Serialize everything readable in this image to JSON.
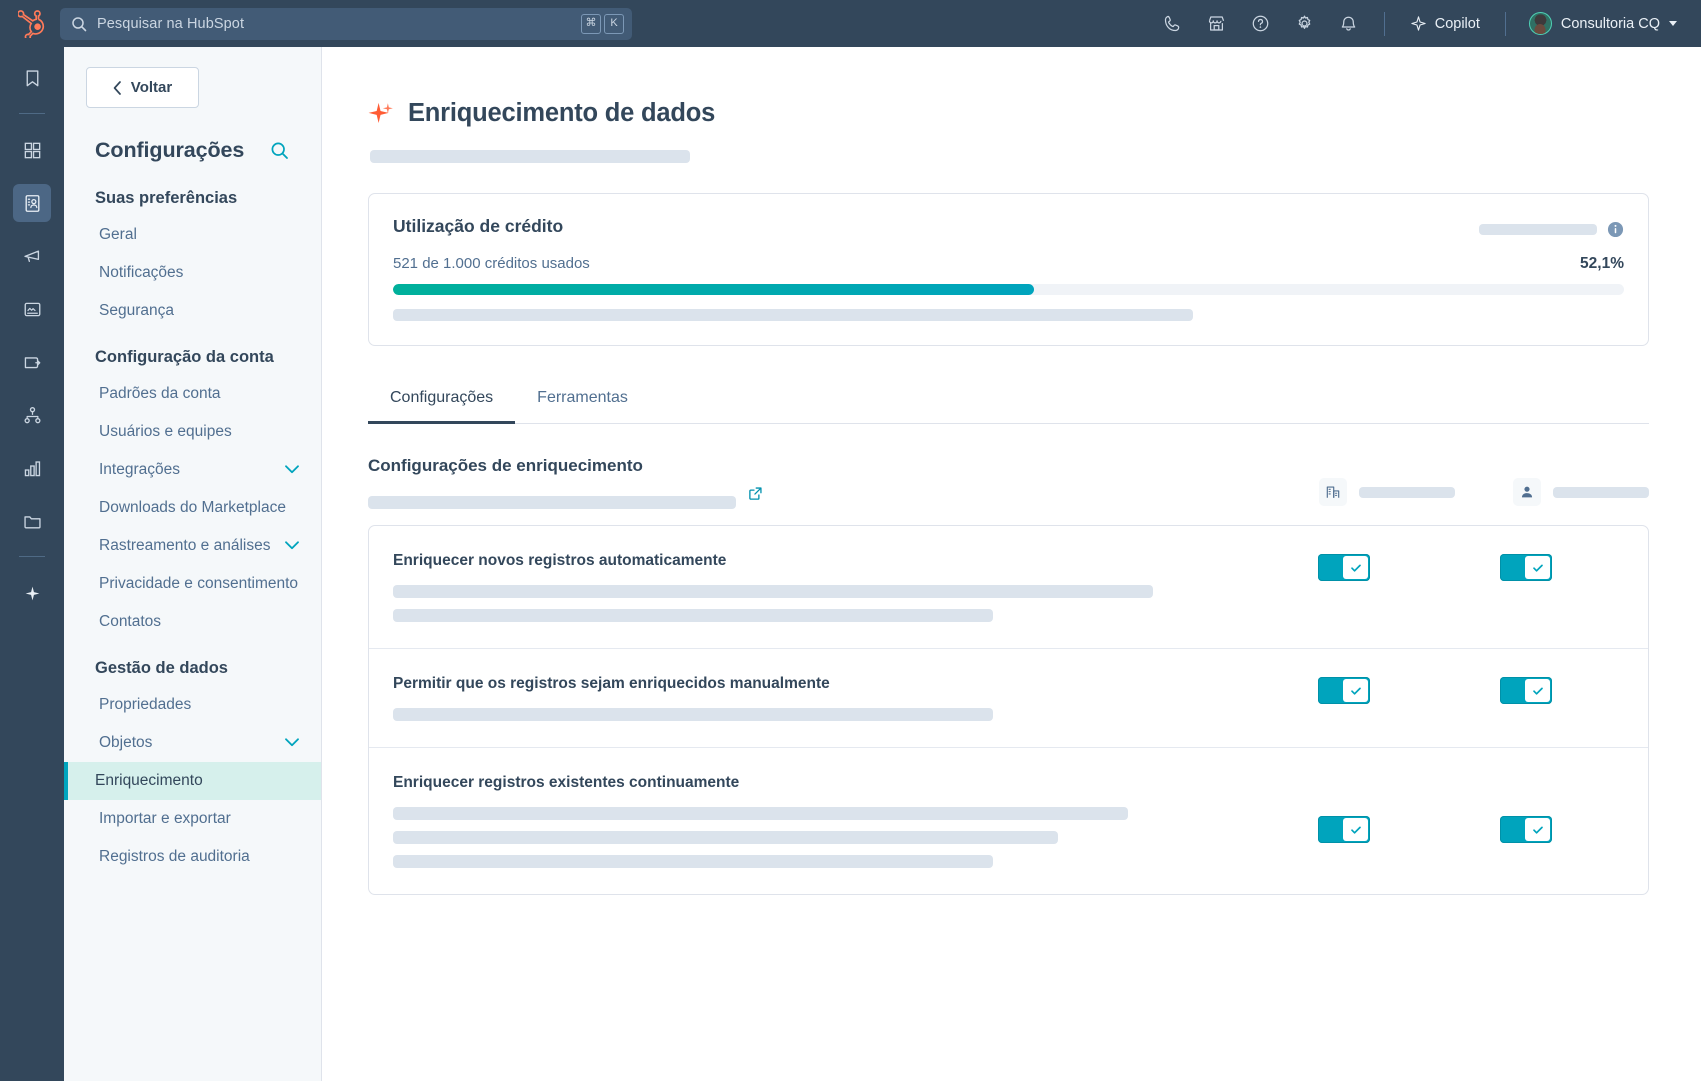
{
  "topnav": {
    "logo_icon": "hubspot-sprocket-logo",
    "search": {
      "placeholder": "Pesquisar na HubSpot",
      "value": "Pesquisar na HubSpot",
      "shortcut_modifier": "⌘",
      "shortcut_key": "K",
      "icon": "search-icon"
    },
    "icons": [
      {
        "name": "calling-icon",
        "glyph": "phone"
      },
      {
        "name": "marketplace-icon",
        "glyph": "store"
      },
      {
        "name": "help-icon",
        "glyph": "question-circle"
      },
      {
        "name": "settings-icon",
        "glyph": "gear"
      },
      {
        "name": "notifications-icon",
        "glyph": "bell"
      }
    ],
    "copilot_label": "Copilot",
    "copilot_icon": "sparkle-icon",
    "account_name": "Consultoria CQ",
    "account_avatar": "user-avatar"
  },
  "rail": {
    "items": [
      {
        "name": "bookmarks-icon",
        "active": false
      },
      {
        "name": "workspaces-icon",
        "active": false
      },
      {
        "name": "crm-contacts-icon",
        "active": true
      },
      {
        "name": "marketing-megaphone-icon",
        "active": false
      },
      {
        "name": "content-icon",
        "active": false
      },
      {
        "name": "commerce-wallet-icon",
        "active": false
      },
      {
        "name": "automation-icon",
        "active": false
      },
      {
        "name": "reporting-bars-icon",
        "active": false
      },
      {
        "name": "library-folder-icon",
        "active": false
      },
      {
        "name": "ai-sparkle-icon",
        "active": false
      }
    ]
  },
  "sidebar": {
    "back_label": "Voltar",
    "back_icon": "chevron-left-icon",
    "title": "Configurações",
    "search_icon": "search-icon",
    "sections": [
      {
        "group": "Suas preferências",
        "items": [
          {
            "label": "Geral",
            "expandable": false,
            "active": false
          },
          {
            "label": "Notificações",
            "expandable": false,
            "active": false
          },
          {
            "label": "Segurança",
            "expandable": false,
            "active": false
          }
        ]
      },
      {
        "group": "Configuração da conta",
        "items": [
          {
            "label": "Padrões da conta",
            "expandable": false,
            "active": false
          },
          {
            "label": "Usuários e equipes",
            "expandable": false,
            "active": false
          },
          {
            "label": "Integrações",
            "expandable": true,
            "active": false
          },
          {
            "label": "Downloads do Marketplace",
            "expandable": false,
            "active": false
          },
          {
            "label": "Rastreamento e análises",
            "expandable": true,
            "active": false
          },
          {
            "label": "Privacidade e consentimento",
            "expandable": false,
            "active": false
          },
          {
            "label": "Contatos",
            "expandable": false,
            "active": false
          }
        ]
      },
      {
        "group": "Gestão de dados",
        "items": [
          {
            "label": "Propriedades",
            "expandable": false,
            "active": false
          },
          {
            "label": "Objetos",
            "expandable": true,
            "active": false
          },
          {
            "label": "Enriquecimento",
            "expandable": false,
            "active": true
          },
          {
            "label": "Importar e exportar",
            "expandable": false,
            "active": false
          },
          {
            "label": "Registros de auditoria",
            "expandable": false,
            "active": false
          }
        ]
      }
    ]
  },
  "main": {
    "page_title": "Enriquecimento de dados",
    "page_title_icon": "sparkle-icon",
    "credit_card": {
      "title": "Utilização de crédito",
      "info_icon": "info-icon",
      "usage_text": "521 de 1.000 créditos usados",
      "percent_label": "52,1%",
      "percent_value": 52.1,
      "credits_used": 521,
      "credits_total": 1000,
      "bar_color": "#00a4bd"
    },
    "tabs": [
      {
        "label": "Configurações",
        "active": true
      },
      {
        "label": "Ferramentas",
        "active": false
      }
    ],
    "section_title": "Configurações de enriquecimento",
    "external_link_icon": "external-link-icon",
    "columns": [
      {
        "icon": "company-building-icon"
      },
      {
        "icon": "contact-person-icon"
      }
    ],
    "rows": [
      {
        "label": "Enriquecer novos registros automaticamente",
        "toggles": [
          {
            "on": true,
            "icon": "check-icon"
          },
          {
            "on": true,
            "icon": "check-icon"
          }
        ],
        "skeleton_widths": [
          760,
          600
        ]
      },
      {
        "label": "Permitir que os registros sejam enriquecidos manualmente",
        "toggles": [
          {
            "on": true,
            "icon": "check-icon"
          },
          {
            "on": true,
            "icon": "check-icon"
          }
        ],
        "skeleton_widths": [
          600
        ]
      },
      {
        "label": "Enriquecer registros existentes continuamente",
        "toggles": [
          {
            "on": true,
            "icon": "check-icon"
          },
          {
            "on": true,
            "icon": "check-icon"
          }
        ],
        "skeleton_widths": [
          735,
          665,
          600
        ]
      }
    ]
  },
  "colors": {
    "nav_background": "#33475b",
    "accent_teal": "#00a4bd",
    "accent_green": "#00b09b",
    "brand_orange": "#ff5c35",
    "sidebar_background": "#f5f8fa",
    "active_item_background": "#d6f0ec",
    "text_primary": "#33475b",
    "text_secondary": "#516f90",
    "skeleton": "#dbe3ec"
  }
}
